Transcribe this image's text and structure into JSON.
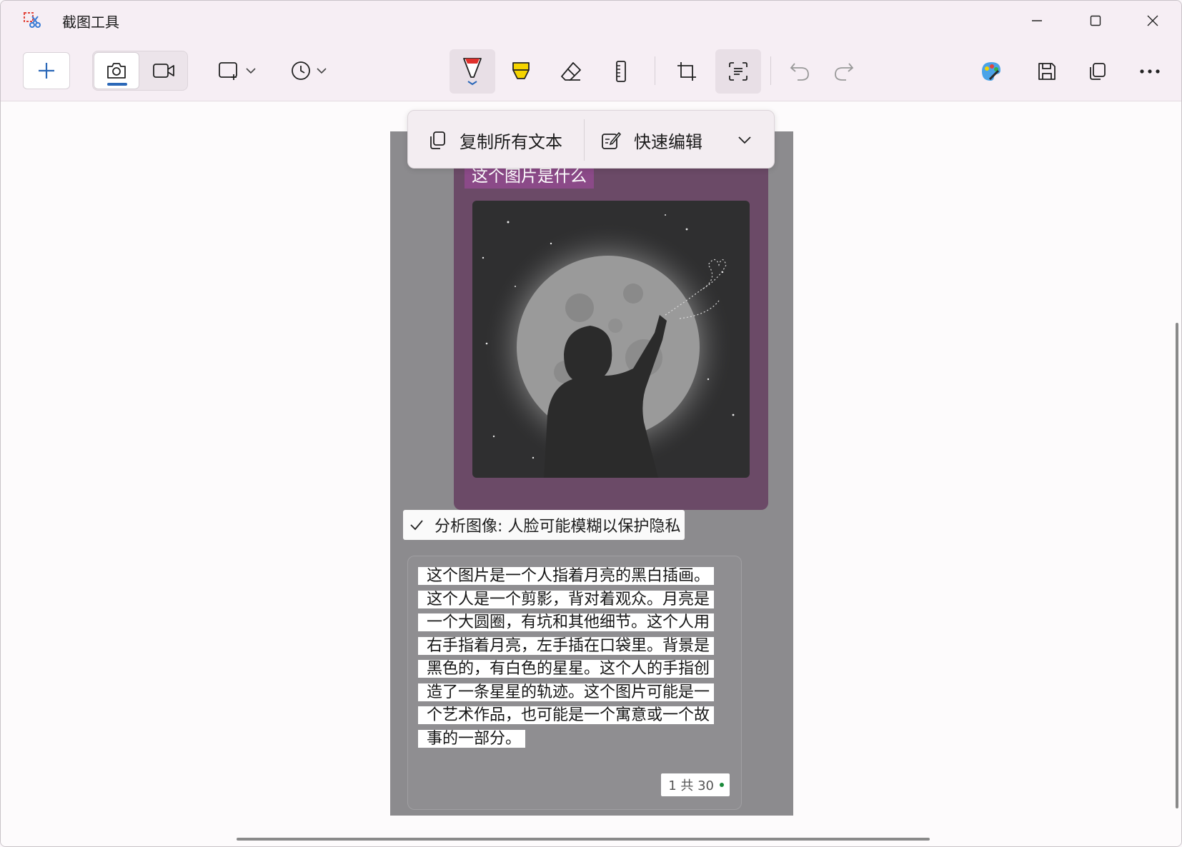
{
  "window": {
    "title": "截图工具"
  },
  "toolbar": {
    "new_label": "+",
    "accent_color": "#2b68b8"
  },
  "text_actions": {
    "copy_all_label": "复制所有文本",
    "quick_edit_label": "快速编辑"
  },
  "screenshot": {
    "question": "这个图片是什么",
    "analysis_label": "分析图像: 人脸可能模糊以保护隐私",
    "answer_lines": [
      "这个图片是一个人指着月亮的黑白插画。",
      "这个人是一个剪影，背对着观众。月亮是",
      "一个大圆圈，有坑和其他细节。这个人用",
      "右手指着月亮，左手插在口袋里。背景是",
      "黑色的，有白色的星星。这个人的手指创",
      "造了一条星星的轨迹。这个图片可能是一",
      "个艺术作品，也可能是一个寓意或一个故",
      "事的一部分。"
    ],
    "counter_label": "1 共 30"
  }
}
